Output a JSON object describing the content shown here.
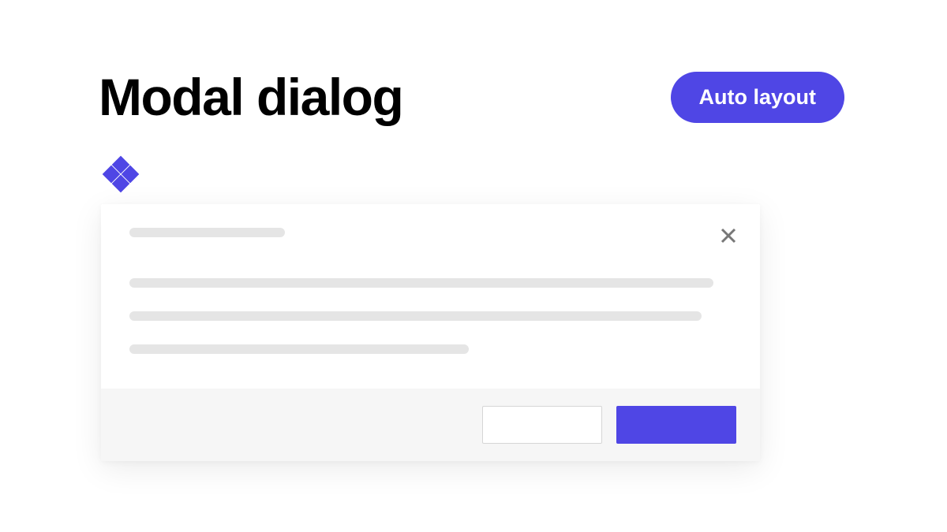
{
  "header": {
    "title": "Modal dialog",
    "badge_label": "Auto layout"
  },
  "icon": {
    "name": "diamond-cluster"
  },
  "dialog": {
    "close_label": "×",
    "footer": {
      "secondary_label": "",
      "primary_label": ""
    }
  },
  "colors": {
    "accent": "#4f46e5",
    "placeholder": "#e5e5e5",
    "footer_bg": "#f6f6f6"
  }
}
